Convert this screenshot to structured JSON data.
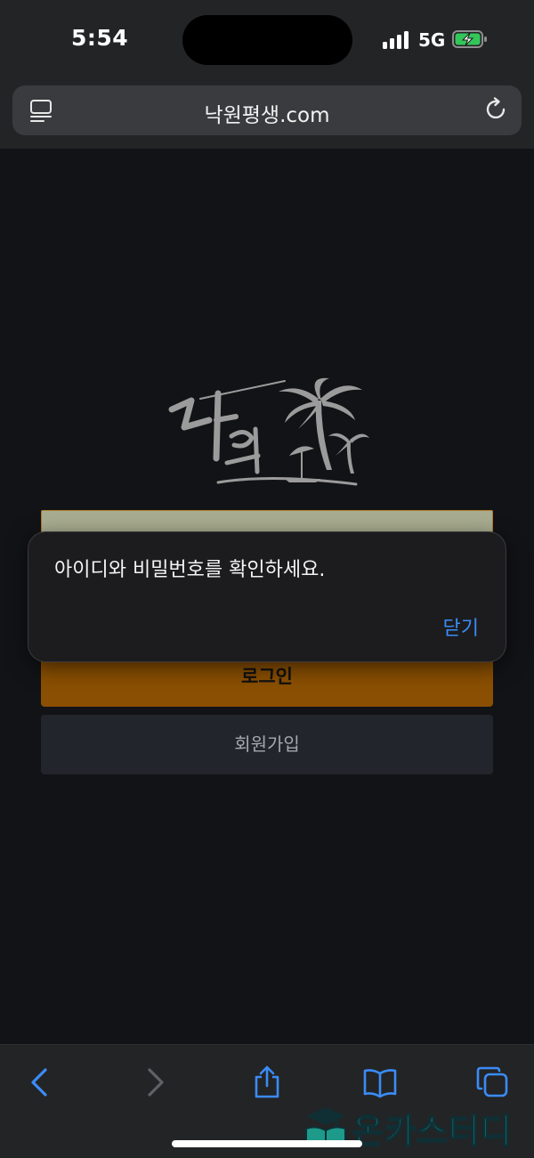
{
  "status_bar": {
    "time": "5:54",
    "network": "5G"
  },
  "browser": {
    "url": "낙원평생.com"
  },
  "logo": {
    "alt_text": "낙원",
    "color": "#9b9b9b"
  },
  "login_form": {
    "login_label": "로그인",
    "signup_label": "회원가입",
    "login_color": "#8a4f02"
  },
  "alert": {
    "message": "아이디와 비밀번호를 확인하세요.",
    "close_label": "닫기"
  },
  "toolbar": {
    "icons": [
      "back-icon",
      "forward-icon",
      "share-icon",
      "bookmarks-icon",
      "tabs-icon"
    ]
  },
  "watermark": {
    "text": "온카스터디"
  }
}
